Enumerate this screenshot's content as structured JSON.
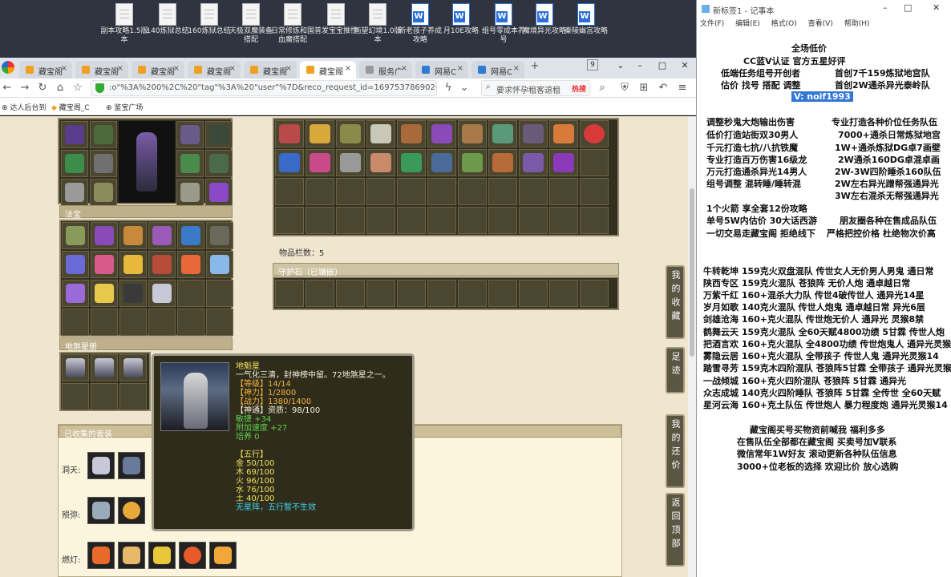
{
  "desktop": {
    "icons": [
      {
        "label": "副本攻略1.5版本",
        "type": "doc"
      },
      {
        "label": "140炼狱总结",
        "type": "doc"
      },
      {
        "label": "160炼狱总结",
        "type": "doc"
      },
      {
        "label": "天极双魔装备搭配",
        "type": "doc"
      },
      {
        "label": "日常修炼和国血魔搭配",
        "type": "doc"
      },
      {
        "label": "普发宝宝推性",
        "type": "doc"
      },
      {
        "label": "画望幻境1.0版本",
        "type": "doc"
      },
      {
        "label": "新老孩子养成攻略",
        "type": "word"
      },
      {
        "label": "月10E攻略",
        "type": "word"
      },
      {
        "label": "组号零成本养号",
        "type": "word"
      },
      {
        "label": "魔境异光攻略",
        "type": "word"
      },
      {
        "label": "秦陵幽宫攻略",
        "type": "word"
      }
    ]
  },
  "browser": {
    "tabs": [
      "藏宝阁",
      "藏宝阁",
      "藏宝阁",
      "藏宝阁",
      "藏宝阁",
      "藏宝阁",
      "服务广",
      "网易C",
      "网易C"
    ],
    "new_tab": "+",
    "tab_counter": "9",
    "url": ":o\"%3A%200%2C%20\"tag\"%3A%20\"user\"%7D&reco_request_id=1697537869026 6YQ5m",
    "search_placeholder": "要求怀孕租客退租",
    "search_hot": "热搜",
    "bookmarks": [
      "达人后台到",
      "藏宝阁_C",
      "鉴宝广场"
    ]
  },
  "game": {
    "sections": {
      "fabao": "法宝",
      "dishabing": "地煞星册",
      "huhu": "守护石（已镶嵌）",
      "suits": "已收集的套装"
    },
    "item_count_label": "物品栏数：",
    "item_count_value": "5",
    "side_buttons": [
      "我的收藏",
      "足迹",
      "我的还价",
      "返回顶部"
    ],
    "tooltip": {
      "name": "地魁星",
      "desc": "一气化三清，封神榜中留。72地煞星之一。",
      "level": "【等级】14/14",
      "shenli": "【神力】1/2800",
      "zhanli": "【战力】1380/1400",
      "shentong": "【神通】资质：98/100",
      "minjie": "敏捷 +34",
      "fujia": "附加速度 +27",
      "peiyang": "培养 0",
      "wuxing_title": "【五行】",
      "jin": "金 50/100",
      "mu": "木 69/100",
      "huo": "火 96/100",
      "shui": "水 76/100",
      "tu": "土 40/100",
      "footer": "无星阵，五行暂不生效"
    },
    "suit_rows": [
      "洞天:",
      "殒弥:",
      "燃灯:"
    ]
  },
  "notepad": {
    "title": "新标签1 - 记事本",
    "menu": [
      "文件(F)",
      "编辑(E)",
      "格式(O)",
      "查看(V)",
      "帮助(H)"
    ],
    "lines": [
      "全场低价",
      "CC蓝V认证  官方五星好评",
      "低端任务组号开创者",
      "首创7千159炼狱地宫队",
      "估价 找号 搭配 调整",
      "首创2W通杀异光泰岭队",
      "V: noif1993",
      "调整秒鬼大炮输出伤害",
      "专业打造各种价位任务队伍",
      "低价打造站街双30男人",
      "7000+通杀日常炼狱地宫",
      "千元打造七抗/八抗铁魔",
      "1W+通杀炼狱DG卓7画壁",
      "专业打造百万伤害16级龙",
      "2W通杀160DG卓混卓画",
      "万元打造通杀异光14男人",
      "2W-3W四阶睡杀160队伍",
      "组号调整 混转睡/睡转混",
      "2W左右异光蹭帮强通异光",
      "3W左右混杀无帮强通异光",
      "1个火箭 享全套12份攻略",
      "单号5W内估价 30大话西游",
      "朋友圈各种在售成品队伍",
      "一切交易走藏宝阁 拒绝线下",
      "严格把控价格 杜绝物次价高",
      "牛转乾坤 159克火双盘混队 传世女人无价男人男鬼 通日常",
      "陕西专区 159克火混队 苍狼阵 无价人炮 通卓越日常",
      "万紫千红 160+混杀大力队 传世4破传世人 通异光14星",
      "岁月如歌 140克火混队 传世人炮鬼 通卓越日常 异光6层",
      "剑雄沧海 160+克火混队 传世炮无价人 通异光 灵猴8禁",
      "鹤舞云天 159克火混队 全60天赋4800功绩 5甘霖 传世人炮",
      "把酒言欢 160+克火混队 全4800功绩 传世炮鬼人 通异光灵猴",
      "雾隐云居 160+克火混队 全带孩子 传世人鬼 通异光灵猴14",
      "踏雪寻芳 159克木四阶混队 苍狼阵5甘霖 全带孩子 通异光灵猴",
      "一战倾城 160+克火四阶混队 苍狼阵 5甘霖 通异光",
      "众志成城 140克火四阶睡队 苍狼阵 5甘霖 全传世 全60天赋",
      "星河云海 160+克土队伍 传世炮人 暴力程度炮 通异光灵猴14",
      "藏宝阁买号买物资前喊我 福利多多",
      "在售队伍全部都在藏宝阁 买卖号加V联系",
      "微信常年1W好友 滚动更新各种队伍信息",
      "3000+位老板的选择 欢迎比价 放心选购"
    ]
  },
  "colors": {
    "page_bg": "#efe6cf",
    "panel_dark": "#34301f",
    "tooltip_orange": "#f2b33c",
    "tooltip_green": "#5fd44a",
    "notepad_highlight": "#3478d6"
  }
}
